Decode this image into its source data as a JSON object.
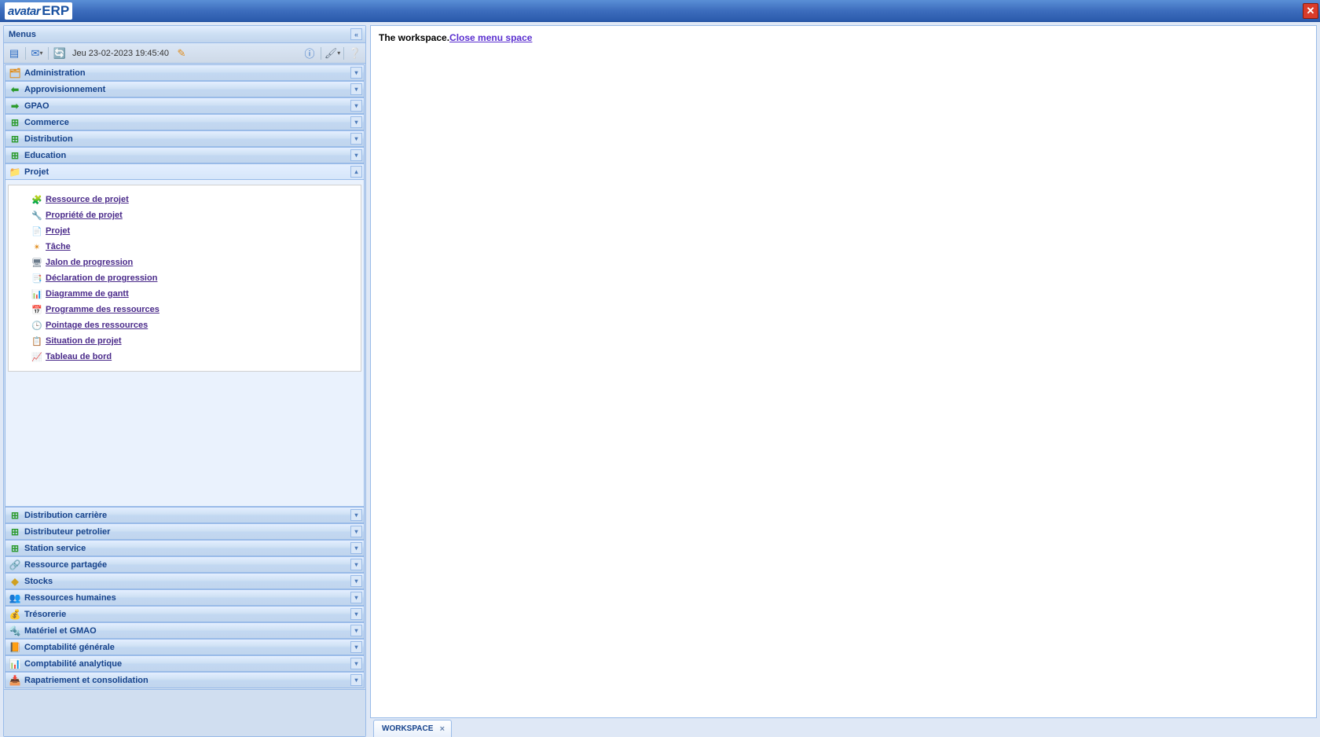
{
  "app": {
    "logo_left": "avatar",
    "logo_right": "ERP"
  },
  "sidebar": {
    "title": "Menus",
    "datetime": "Jeu 23-02-2023 19:45:40"
  },
  "accordion": [
    {
      "label": "Administration",
      "icon": "🗂",
      "cls": "c-orange",
      "expanded": false
    },
    {
      "label": "Approvisionnement",
      "icon": "⬅",
      "cls": "c-green",
      "expanded": false
    },
    {
      "label": "GPAO",
      "icon": "➡",
      "cls": "c-green",
      "expanded": false
    },
    {
      "label": "Commerce",
      "icon": "⊞",
      "cls": "c-green",
      "expanded": false
    },
    {
      "label": "Distribution",
      "icon": "⊞",
      "cls": "c-green",
      "expanded": false
    },
    {
      "label": "Education",
      "icon": "⊞",
      "cls": "c-green",
      "expanded": false
    },
    {
      "label": "Projet",
      "icon": "📁",
      "cls": "c-teal",
      "expanded": true,
      "items": [
        {
          "label": " Ressource de projet",
          "icon": "🧩",
          "cls": "c-teal"
        },
        {
          "label": " Propriété de projet",
          "icon": "🔧",
          "cls": "c-blue"
        },
        {
          "label": " Projet",
          "icon": "📄",
          "cls": "c-yellow"
        },
        {
          "label": " Tâche",
          "icon": "✴",
          "cls": "c-orange"
        },
        {
          "label": " Jalon de progression",
          "icon": "🖥",
          "cls": "c-gray"
        },
        {
          "label": " Déclaration de progression",
          "icon": "📑",
          "cls": "c-blue"
        },
        {
          "label": " Diagramme de gantt",
          "icon": "📊",
          "cls": "c-gray"
        },
        {
          "label": " Programme des ressources",
          "icon": "📅",
          "cls": "c-red"
        },
        {
          "label": " Pointage des ressources",
          "icon": "🕒",
          "cls": "c-blue"
        },
        {
          "label": " Situation de projet",
          "icon": "📋",
          "cls": "c-blue"
        },
        {
          "label": " Tableau de bord",
          "icon": "📈",
          "cls": "c-green"
        }
      ]
    },
    {
      "label": "Distribution carrière",
      "icon": "⊞",
      "cls": "c-green",
      "expanded": false
    },
    {
      "label": "Distributeur petrolier",
      "icon": "⊞",
      "cls": "c-green",
      "expanded": false
    },
    {
      "label": "Station service",
      "icon": "⊞",
      "cls": "c-green",
      "expanded": false
    },
    {
      "label": "Ressource partagée",
      "icon": "🔗",
      "cls": "c-teal",
      "expanded": false
    },
    {
      "label": "Stocks",
      "icon": "◆",
      "cls": "c-yellow",
      "expanded": false
    },
    {
      "label": "Ressources humaines",
      "icon": "👥",
      "cls": "c-orange",
      "expanded": false
    },
    {
      "label": "Trésorerie",
      "icon": "💰",
      "cls": "c-yellow",
      "expanded": false
    },
    {
      "label": "Matériel et GMAO",
      "icon": "🔩",
      "cls": "c-gray",
      "expanded": false
    },
    {
      "label": "Comptabilité générale",
      "icon": "📙",
      "cls": "c-orange",
      "expanded": false
    },
    {
      "label": "Comptabilité analytique",
      "icon": "📊",
      "cls": "c-green",
      "expanded": false
    },
    {
      "label": "Rapatriement et consolidation",
      "icon": "📥",
      "cls": "c-orange",
      "expanded": false
    }
  ],
  "workspace": {
    "text": "The workspace.",
    "link": "Close menu space",
    "tab": "WORKSPACE"
  }
}
